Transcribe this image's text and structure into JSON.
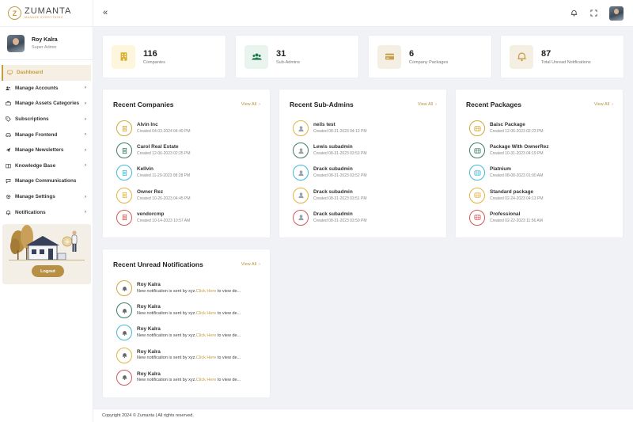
{
  "brand": {
    "name": "ZUMANTA",
    "tagline": "MANAGE EVERYTHING",
    "mark": "Z",
    "accent": "#c79b3f"
  },
  "user": {
    "name": "Roy Kalra",
    "role": "Super Admin"
  },
  "header": {
    "collapse_icon": "«"
  },
  "sidebar": {
    "items": [
      {
        "label": "Dashboard",
        "icon": "monitor-icon",
        "active": true,
        "chevron": ""
      },
      {
        "label": "Manage Accounts",
        "icon": "users-icon",
        "chevron": "›"
      },
      {
        "label": "Manage Assets Categories",
        "icon": "briefcase-icon",
        "chevron": "›"
      },
      {
        "label": "Subscriptions",
        "icon": "tag-icon",
        "chevron": "›"
      },
      {
        "label": "Manage Frontend",
        "icon": "car-icon",
        "chevron": "›"
      },
      {
        "label": "Manage Newsletters",
        "icon": "send-icon",
        "chevron": "›"
      },
      {
        "label": "Knowledge Base",
        "icon": "book-icon",
        "chevron": "›"
      },
      {
        "label": "Manage Communications",
        "icon": "chat-icon",
        "chevron": ""
      },
      {
        "label": "Manage Settings",
        "icon": "gear-icon",
        "chevron": "›"
      },
      {
        "label": "Notifications",
        "icon": "bell-icon",
        "chevron": "›"
      }
    ],
    "logout_label": "Logout"
  },
  "stats": [
    {
      "value": "116",
      "label": "Companies",
      "icon": "building-icon",
      "bg": "#fdf6dc",
      "color": "#d6ad2b"
    },
    {
      "value": "31",
      "label": "Sub-Admins",
      "icon": "users-group-icon",
      "bg": "#e9f4ee",
      "color": "#1f7a4d"
    },
    {
      "value": "6",
      "label": "Company Packages",
      "icon": "card-icon",
      "bg": "#f5efe3",
      "color": "#c89e4a"
    },
    {
      "value": "87",
      "label": "Total Unread Notifications",
      "icon": "bell-icon",
      "bg": "#f5efe3",
      "color": "#c89e4a"
    }
  ],
  "view_all_label": "View All",
  "view_all_chevron": "›",
  "recent_companies": {
    "title": "Recent Companies",
    "items": [
      {
        "name": "Alvin Inc",
        "created": "Created 04-03-2024 04:49 PM",
        "color": "#d3a83a"
      },
      {
        "name": "Carol Real Estate",
        "created": "Created 12-06-2023 02:25 PM",
        "color": "#3e7d66"
      },
      {
        "name": "Kellvin",
        "created": "Created 11-29-2023 08:28 PM",
        "color": "#42b9d6"
      },
      {
        "name": "Owner Rez",
        "created": "Created 10-26-2023 04:45 PM",
        "color": "#e2b43c"
      },
      {
        "name": "vendorcmp",
        "created": "Created 10-14-2023 10:57 AM",
        "color": "#d95757"
      }
    ]
  },
  "recent_subadmins": {
    "title": "Recent Sub-Admins",
    "items": [
      {
        "name": "neils test",
        "created": "Created 08-31-2023 04:12 PM",
        "color": "#e0b445"
      },
      {
        "name": "Lewis subadmin",
        "created": "Created 08-31-2023 03:53 PM",
        "color": "#3e7d66"
      },
      {
        "name": "Drack subadmin",
        "created": "Created 08-31-2023 03:52 PM",
        "color": "#42b9d6"
      },
      {
        "name": "Drack subadmin",
        "created": "Created 08-31-2023 03:51 PM",
        "color": "#e2b43c"
      },
      {
        "name": "Drack subadmin",
        "created": "Created 08-31-2023 03:50 PM",
        "color": "#d95757"
      }
    ]
  },
  "recent_packages": {
    "title": "Recent Packages",
    "items": [
      {
        "name": "Baisc Package",
        "created": "Created 12-06-2023 02:23 PM",
        "color": "#d3a83a"
      },
      {
        "name": "Package With OwnerRez",
        "created": "Created 10-31-2023 04:19 PM",
        "color": "#3e7d66"
      },
      {
        "name": "Platnium",
        "created": "Created 08-08-2023 01:00 AM",
        "color": "#42b9d6"
      },
      {
        "name": "Standard package",
        "created": "Created 02-24-2023 04:13 PM",
        "color": "#e2b43c"
      },
      {
        "name": "Professional",
        "created": "Created 02-22-2023 11:56 AM",
        "color": "#d95757"
      }
    ]
  },
  "recent_notifications": {
    "title": "Recent Unread Notifications",
    "items": [
      {
        "name": "Roy Kalra",
        "text": "New notification is sent by xyz.",
        "link": "Click Here",
        "suffix": " to view de...",
        "color": "#d3a83a"
      },
      {
        "name": "Roy Kalra",
        "text": "New notification is sent by xyz.",
        "link": "Click Here",
        "suffix": " to view de...",
        "color": "#3e7d66"
      },
      {
        "name": "Roy Kalra",
        "text": "New notification is sent by xyz.",
        "link": "Click Here",
        "suffix": " to view de...",
        "color": "#42b9d6"
      },
      {
        "name": "Roy Kalra",
        "text": "New notification is sent by xyz.",
        "link": "Click Here",
        "suffix": " to view de...",
        "color": "#e2b43c"
      },
      {
        "name": "Roy Kalra",
        "text": "New notification is sent by xyz.",
        "link": "Click Here",
        "suffix": " to view de...",
        "color": "#d95757"
      }
    ]
  },
  "footer": {
    "text": "Copyright 2024 © Zumanta | All rights reserved."
  }
}
